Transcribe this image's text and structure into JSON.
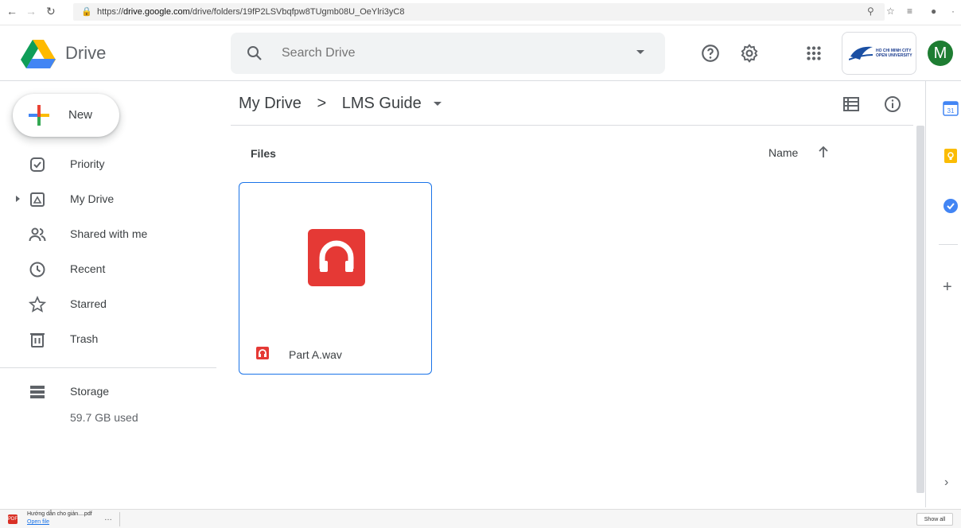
{
  "browser": {
    "url_prefix": "https://",
    "url_host": "drive.google.com",
    "url_path": "/drive/folders/19fP2LSVbqfpw8TUgmb08U_OeYlri3yC8"
  },
  "header": {
    "brand": "Drive",
    "search_placeholder": "Search Drive",
    "org_text": "HO CHI MINH CITY OPEN UNIVERSITY",
    "avatar_letter": "M"
  },
  "sidebar": {
    "new_label": "New",
    "items": [
      {
        "label": "Priority"
      },
      {
        "label": "My Drive"
      },
      {
        "label": "Shared with me"
      },
      {
        "label": "Recent"
      },
      {
        "label": "Starred"
      },
      {
        "label": "Trash"
      }
    ],
    "storage_label": "Storage",
    "storage_used": "59.7 GB used"
  },
  "main": {
    "breadcrumb_root": "My Drive",
    "breadcrumb_sep": ">",
    "breadcrumb_current": "LMS Guide",
    "section_label": "Files",
    "sort_label": "Name",
    "file_name": "Part A.wav"
  },
  "sidepanel": {
    "calendar_day": "31"
  },
  "download_bar": {
    "file_name": "Hướng dẫn cho giản....pdf",
    "open_label": "Open file",
    "more": "…",
    "show_all": "Show all"
  },
  "colors": {
    "accent": "#1a73e8",
    "audio_red": "#e53935",
    "avatar_green": "#1e7d32"
  }
}
